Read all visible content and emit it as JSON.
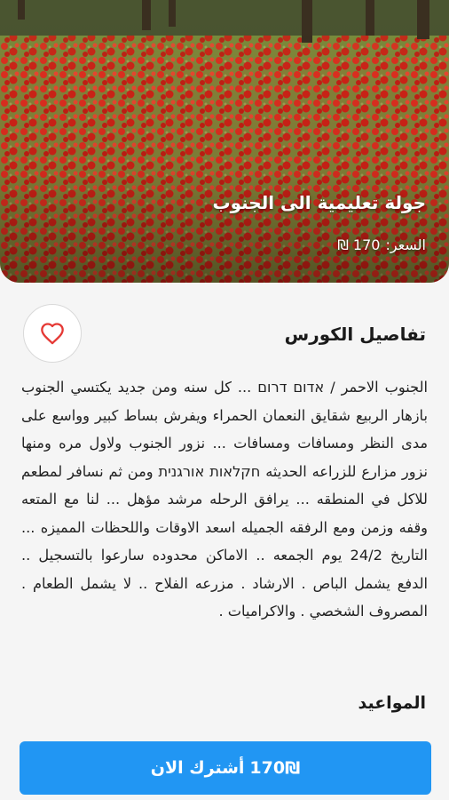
{
  "hero": {
    "title": "جولة تعليمية الى الجنوب",
    "price_label": "السعر:",
    "price_value": "170 ₪"
  },
  "details": {
    "title": "تفاصيل الكورس",
    "favorite_icon": "heart-outline-icon",
    "description": "الجنوب الاحمر / אדום דרום ... كل سنه ومن جديد يكتسي الجنوب بازهار الربيع شقايق النعمان الحمراء ويفرش بساط كبير وواسع على مدى النظر ومسافات ومسافات ... نزور الجنوب ولاول مره ومنها نزور مزارع للزراعه الحديثه חקלאות אורגנית ومن ثم نسافر لمطعم للاكل في المنطقه ... يرافق الرحله مرشد مؤهل ... لنا مع المتعه وقفه وزمن ومع الرفقه الجميله اسعد الاوقات واللحظات المميزه ... التاريخ 24/2 يوم الجمعه .. الاماكن محدوده سارعوا بالتسجيل .. الدفع يشمل الباص . الارشاد . مزرعه الفلاح .. لا يشمل الطعام . المصروف الشخصي . والاكراميات ."
  },
  "schedule": {
    "title": "المواعيد"
  },
  "subscribe": {
    "price": "170₪",
    "label": "أشترك الان"
  },
  "colors": {
    "accent": "#2196f3",
    "heart": "#e53935"
  }
}
